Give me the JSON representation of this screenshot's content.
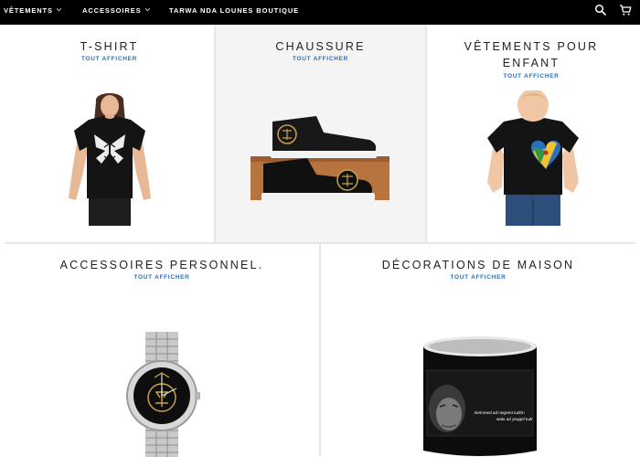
{
  "nav": {
    "items": [
      {
        "label": "VÊTEMENTS",
        "has_dropdown": true
      },
      {
        "label": "ACCESSOIRES",
        "has_dropdown": true
      },
      {
        "label": "TARWA NDA LOUNES BOUTIQUE",
        "has_dropdown": false
      }
    ],
    "icons": [
      "search-icon",
      "cart-icon"
    ]
  },
  "collections": [
    {
      "title": "T-SHIRT",
      "link": "TOUT AFFICHER",
      "image": "woman-black-tshirt"
    },
    {
      "title": "CHAUSSURE",
      "link": "TOUT AFFICHER",
      "image": "black-high-top-sneakers"
    },
    {
      "title": "VÊTEMENTS POUR",
      "title_line2": "ENFANT",
      "link": "TOUT AFFICHER",
      "image": "toddler-black-tshirt"
    },
    {
      "title": "ACCESSOIRES PERSONNEL.",
      "link": "TOUT AFFICHER",
      "image": "steel-wristwatch"
    },
    {
      "title": "DÉCORATIONS DE MAISON",
      "link": "TOUT AFFICHER",
      "image": "black-mug",
      "mug_text_1": "Nemmed ad negrent tudrin",
      "mug_text_2": "walu ad yeqqel tudr"
    }
  ],
  "colors": {
    "nav_background": "#000000",
    "link_blue": "#2a6fb8",
    "emblem_gold": "#c8a24a"
  }
}
